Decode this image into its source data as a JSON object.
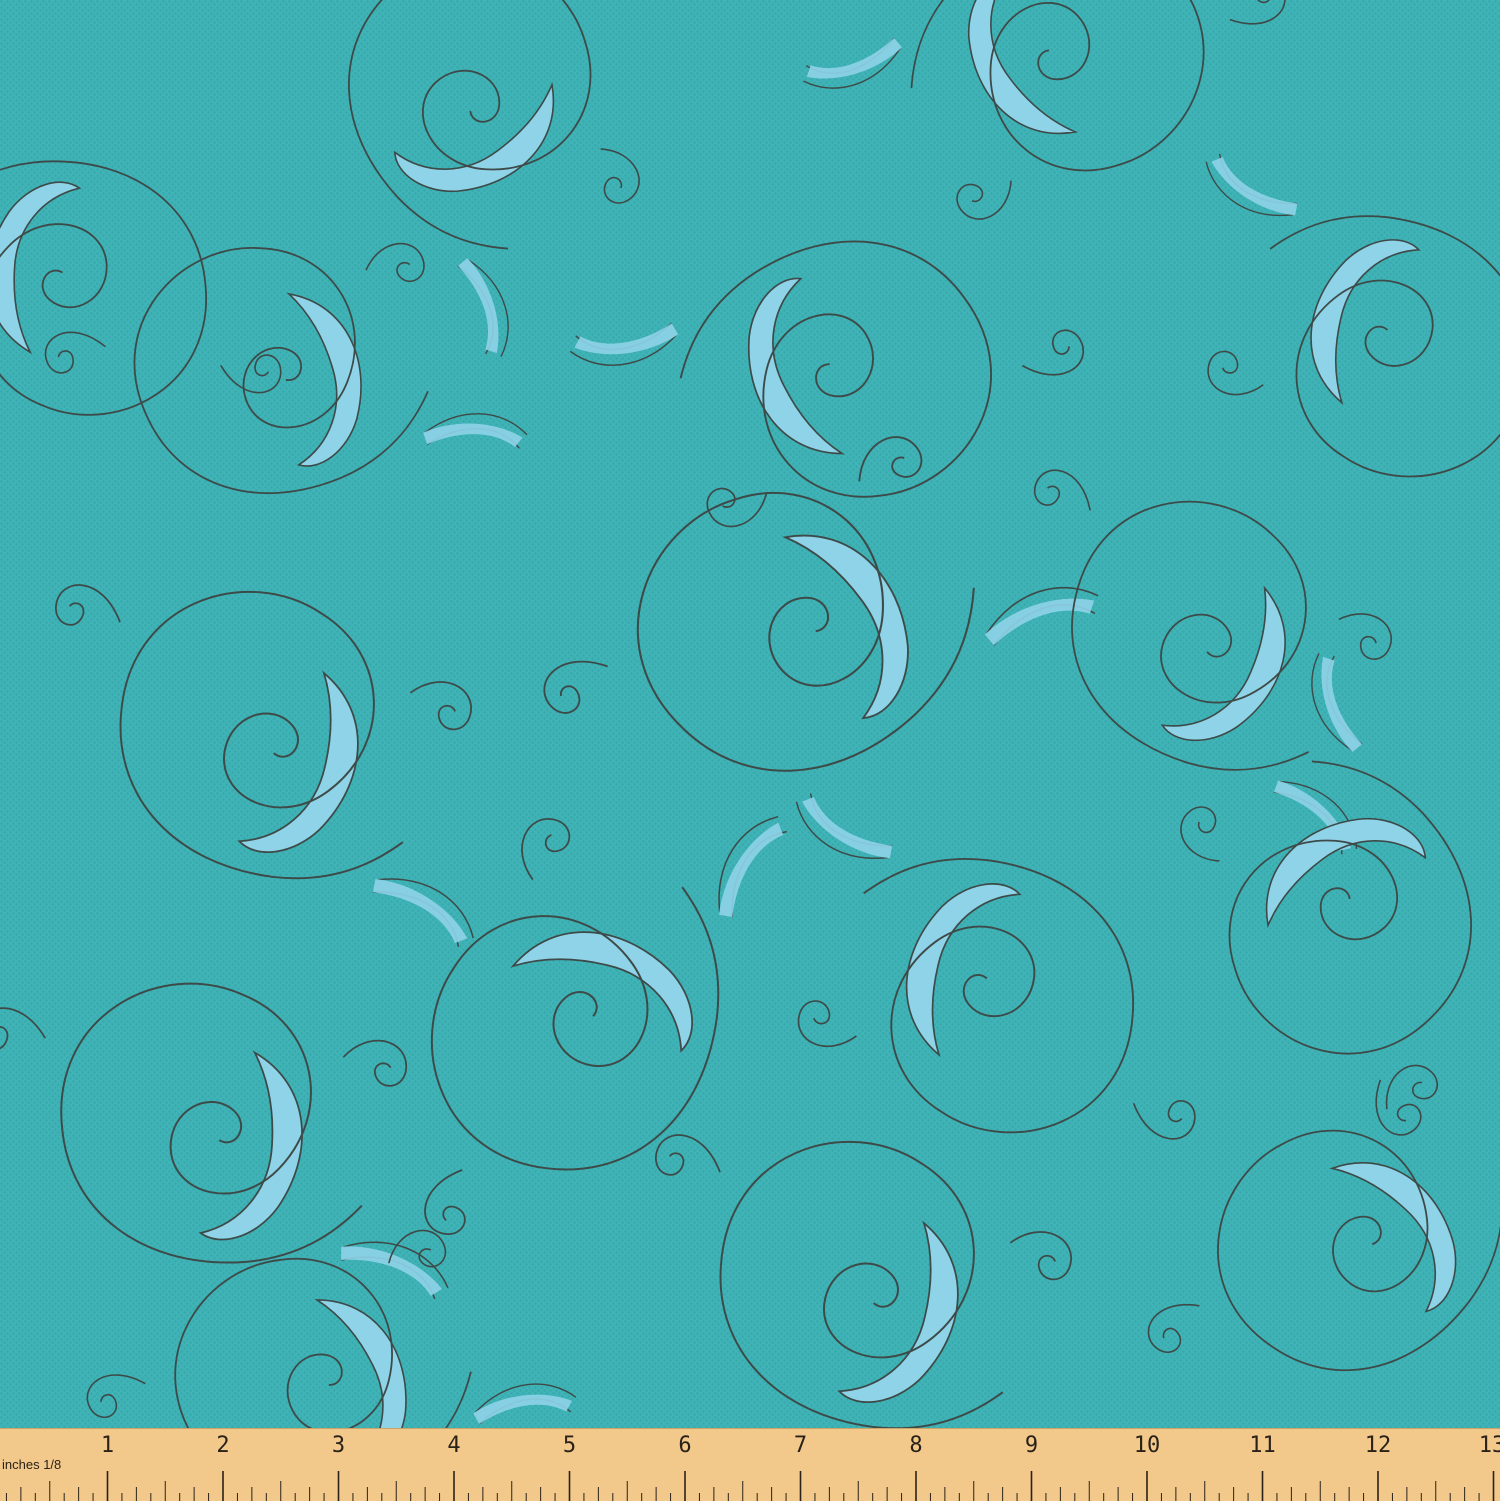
{
  "image": {
    "subject": "Turquoise fabric swatch with swirling paisley line-art print",
    "colors": {
      "background": "#3fb3b6",
      "ribbon_fill": "#8fd3e8",
      "outline": "#3d4a48",
      "ruler_bg": "#f2c98b",
      "ruler_ink": "#2a2218"
    }
  },
  "ruler": {
    "unit_label": "inches 1/8",
    "numbers": [
      "1",
      "2",
      "3",
      "4",
      "5",
      "6",
      "7",
      "8",
      "9",
      "10",
      "11",
      "12",
      "13"
    ]
  }
}
